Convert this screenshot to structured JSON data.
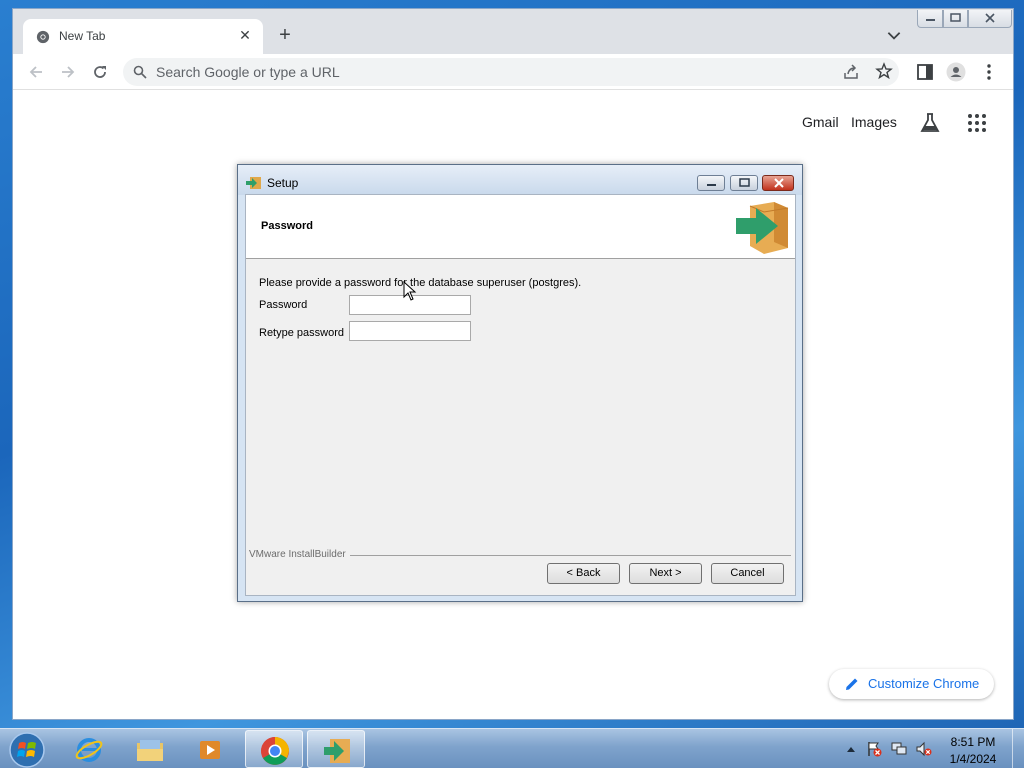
{
  "browser": {
    "tab": {
      "title": "New Tab"
    },
    "omnibox": {
      "placeholder": "Search Google or type a URL"
    },
    "ntp": {
      "links": [
        "Gmail",
        "Images"
      ],
      "customize_label": "Customize Chrome"
    }
  },
  "setup": {
    "title": "Setup",
    "header_title": "Password",
    "prompt": "Please provide a password for the database superuser (postgres).",
    "fields": [
      {
        "label": "Password",
        "value": ""
      },
      {
        "label": "Retype password",
        "value": ""
      }
    ],
    "brand": "VMware InstallBuilder",
    "buttons": {
      "back": "< Back",
      "next": "Next >",
      "cancel": "Cancel"
    }
  },
  "taskbar": {
    "time": "8:51 PM",
    "date": "1/4/2024",
    "pinned": [
      "internet-explorer-icon",
      "file-explorer-icon",
      "media-player-icon",
      "chrome-icon",
      "setup-installer-icon"
    ]
  }
}
